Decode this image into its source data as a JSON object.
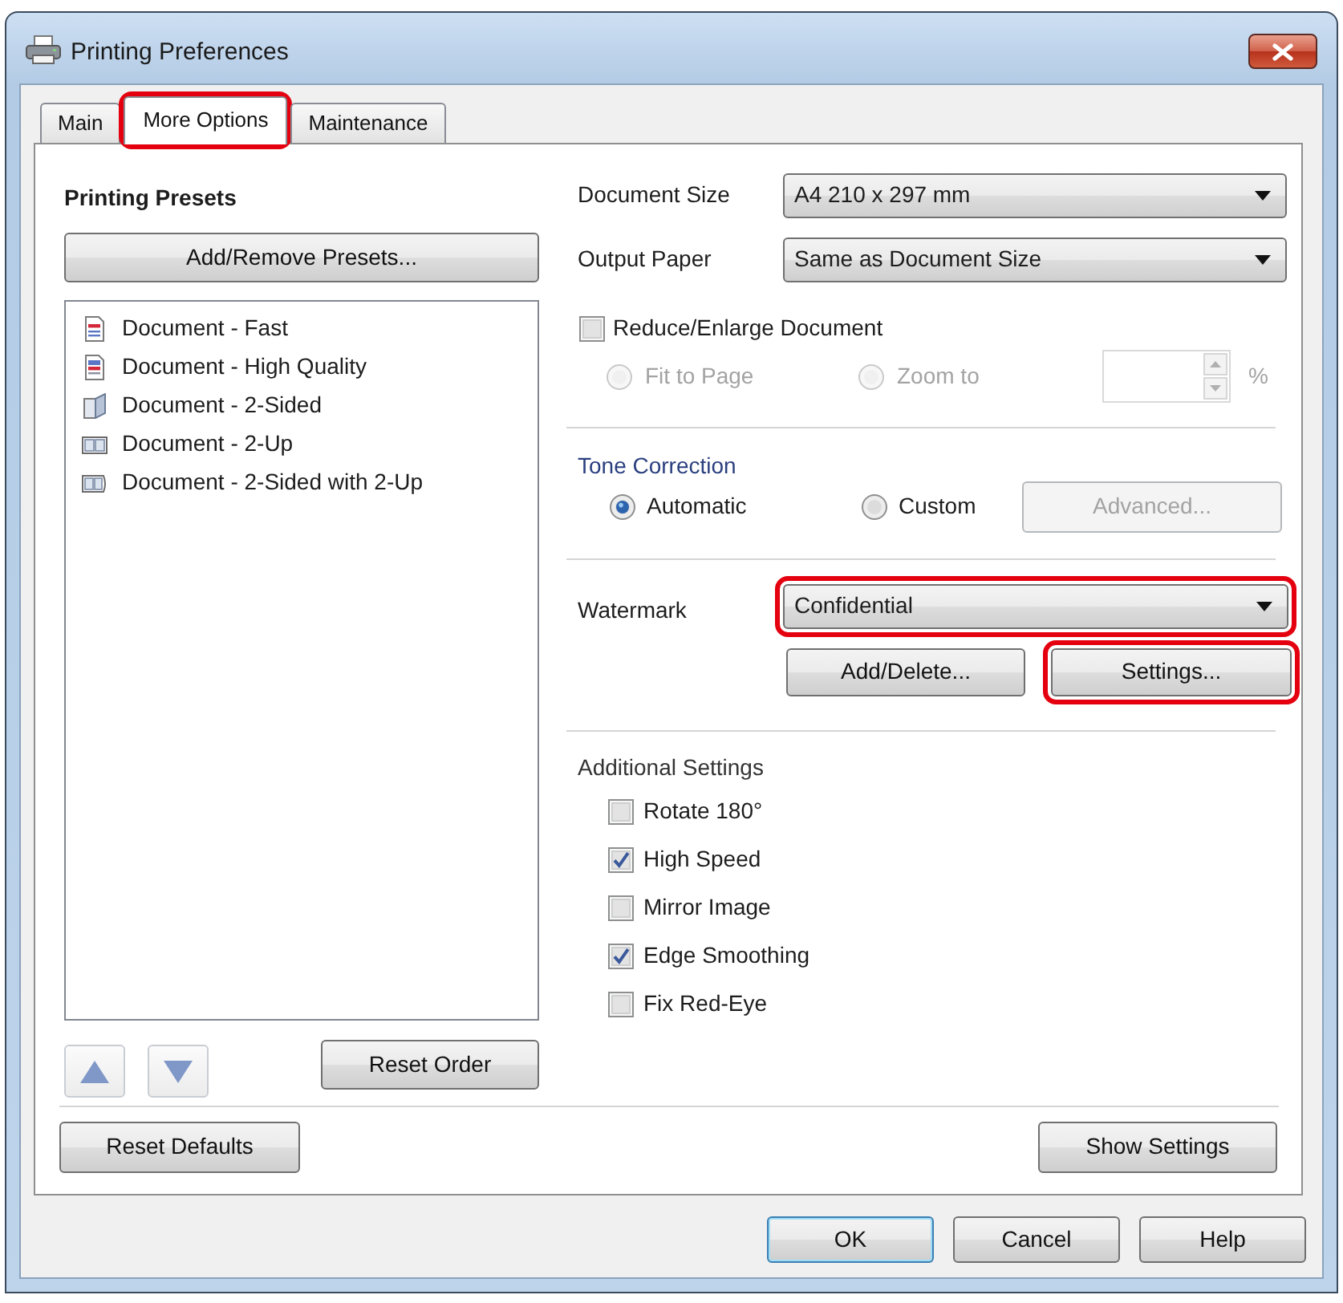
{
  "window": {
    "title": "Printing Preferences"
  },
  "tabs": [
    {
      "label": "Main",
      "selected": false,
      "highlighted": false
    },
    {
      "label": "More Options",
      "selected": true,
      "highlighted": true
    },
    {
      "label": "Maintenance",
      "selected": false,
      "highlighted": false
    }
  ],
  "presets": {
    "title": "Printing Presets",
    "add_remove_button": "Add/Remove Presets...",
    "items": [
      {
        "label": "Document - Fast",
        "kind": "fast",
        "selected": false
      },
      {
        "label": "Document - High Quality",
        "kind": "quality",
        "selected": false
      },
      {
        "label": "Document - 2-Sided",
        "kind": "duplex",
        "selected": false
      },
      {
        "label": "Document - 2-Up",
        "kind": "two_up",
        "selected": false
      },
      {
        "label": "Document - 2-Sided with 2-Up",
        "kind": "duplex_two_up",
        "selected": false
      }
    ],
    "reset_order_button": "Reset Order"
  },
  "paper": [
    {
      "label": "Document Size",
      "value": "A4 210 x 297 mm"
    },
    {
      "label": "Output Paper",
      "value": "Same as Document Size"
    }
  ],
  "reduce_enlarge": {
    "label": "Reduce/Enlarge Document",
    "checked": false,
    "options": [
      {
        "label": "Fit to Page",
        "selected": false,
        "disabled": true
      },
      {
        "label": "Zoom to",
        "selected": false,
        "disabled": true
      }
    ],
    "zoom_field": {
      "disabled": true
    },
    "unit": "%"
  },
  "tone_correction": {
    "title": "Tone Correction",
    "options": [
      {
        "label": "Automatic",
        "selected": true
      },
      {
        "label": "Custom",
        "selected": false
      }
    ],
    "advanced_button": {
      "label": "Advanced...",
      "disabled": true
    }
  },
  "watermark": {
    "label": "Watermark",
    "value": "Confidential",
    "highlighted": true,
    "buttons": [
      {
        "label": "Add/Delete...",
        "highlighted": false
      },
      {
        "label": "Settings...",
        "highlighted": true
      }
    ]
  },
  "additional_settings": {
    "title": "Additional Settings",
    "items": [
      {
        "label": "Rotate 180°",
        "checked": false
      },
      {
        "label": "High Speed",
        "checked": true
      },
      {
        "label": "Mirror Image",
        "checked": false
      },
      {
        "label": "Edge Smoothing",
        "checked": true
      },
      {
        "label": "Fix Red-Eye",
        "checked": false
      }
    ]
  },
  "footer": {
    "reset_defaults_button": "Reset Defaults",
    "show_settings_button": "Show Settings"
  },
  "dialog_buttons": [
    {
      "label": "OK",
      "default": true
    },
    {
      "label": "Cancel",
      "default": false
    },
    {
      "label": "Help",
      "default": false
    }
  ]
}
